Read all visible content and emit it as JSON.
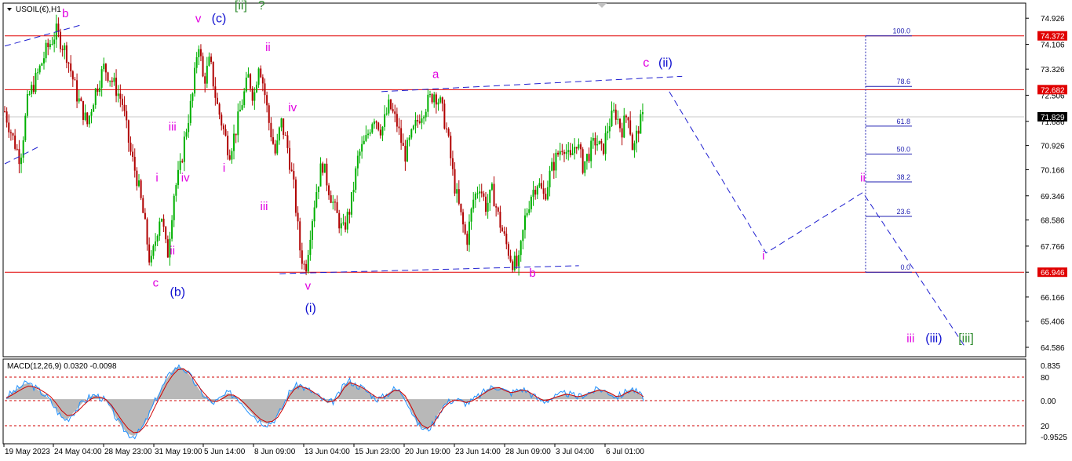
{
  "header": {
    "symbol_label": "USOIL(€),H1"
  },
  "chart_data": {
    "type": "candlestick",
    "price_axis": {
      "ticks": [
        "74.926",
        "74.106",
        "73.326",
        "72.506",
        "71.686",
        "70.926",
        "70.166",
        "69.346",
        "68.586",
        "67.766",
        "66.946",
        "66.166",
        "65.406",
        "64.586"
      ],
      "ylim": [
        64.34,
        75.35
      ]
    },
    "time_axis": {
      "ticks": [
        "19 May 2023",
        "24 May 04:00",
        "28 May 23:00",
        "31 May 19:00",
        "5 Jun 14:00",
        "8 Jun 09:00",
        "13 Jun 04:00",
        "15 Jun 23:00",
        "20 Jun 19:00",
        "23 Jun 14:00",
        "28 Jun 09:00",
        "3 Jul 04:00",
        "6 Jul 01:00"
      ]
    },
    "horizontal_levels": [
      {
        "price": 74.372,
        "label": "74.372",
        "color": "#e00000"
      },
      {
        "price": 72.682,
        "label": "72.682",
        "color": "#e00000"
      },
      {
        "price": 66.946,
        "label": "66.946",
        "color": "#e00000"
      }
    ],
    "current_price": {
      "price": 71.829,
      "label": "71.829"
    },
    "fibonacci": {
      "from": 66.946,
      "to": 74.372,
      "levels": [
        {
          "ratio": 1.0,
          "label": "100.0"
        },
        {
          "ratio": 0.786,
          "label": "78.6"
        },
        {
          "ratio": 0.618,
          "label": "61.8"
        },
        {
          "ratio": 0.5,
          "label": "50.0"
        },
        {
          "ratio": 0.382,
          "label": "38.2"
        },
        {
          "ratio": 0.236,
          "label": "23.6"
        },
        {
          "ratio": 0.0,
          "label": "0.0"
        }
      ]
    },
    "price_points": [
      {
        "t": 0,
        "p": 72.0
      },
      {
        "t": 6,
        "p": 71.2
      },
      {
        "t": 12,
        "p": 70.5
      },
      {
        "t": 18,
        "p": 72.4
      },
      {
        "t": 25,
        "p": 73.1
      },
      {
        "t": 32,
        "p": 73.9
      },
      {
        "t": 40,
        "p": 74.5
      },
      {
        "t": 48,
        "p": 73.8
      },
      {
        "t": 56,
        "p": 72.5
      },
      {
        "t": 64,
        "p": 71.6
      },
      {
        "t": 70,
        "p": 72.6
      },
      {
        "t": 77,
        "p": 73.4
      },
      {
        "t": 84,
        "p": 72.9
      },
      {
        "t": 91,
        "p": 72.3
      },
      {
        "t": 97,
        "p": 70.8
      },
      {
        "t": 103,
        "p": 69.8
      },
      {
        "t": 108,
        "p": 68.6
      },
      {
        "t": 113,
        "p": 67.1
      },
      {
        "t": 117,
        "p": 68.0
      },
      {
        "t": 121,
        "p": 68.9
      },
      {
        "t": 126,
        "p": 67.4
      },
      {
        "t": 131,
        "p": 69.4
      },
      {
        "t": 136,
        "p": 70.2
      },
      {
        "t": 140,
        "p": 71.3
      },
      {
        "t": 146,
        "p": 72.6
      },
      {
        "t": 150,
        "p": 74.3
      },
      {
        "t": 154,
        "p": 72.9
      },
      {
        "t": 159,
        "p": 73.6
      },
      {
        "t": 164,
        "p": 72.3
      },
      {
        "t": 169,
        "p": 71.5
      },
      {
        "t": 174,
        "p": 70.7
      },
      {
        "t": 179,
        "p": 71.4
      },
      {
        "t": 184,
        "p": 72.3
      },
      {
        "t": 189,
        "p": 73.1
      },
      {
        "t": 193,
        "p": 72.4
      },
      {
        "t": 197,
        "p": 73.6
      },
      {
        "t": 201,
        "p": 72.7
      },
      {
        "t": 205,
        "p": 71.6
      },
      {
        "t": 210,
        "p": 70.6
      },
      {
        "t": 214,
        "p": 71.7
      },
      {
        "t": 219,
        "p": 70.9
      },
      {
        "t": 224,
        "p": 69.6
      },
      {
        "t": 229,
        "p": 67.6
      },
      {
        "t": 233,
        "p": 67.0
      },
      {
        "t": 237,
        "p": 68.3
      },
      {
        "t": 241,
        "p": 69.4
      },
      {
        "t": 246,
        "p": 70.4
      },
      {
        "t": 251,
        "p": 69.6
      },
      {
        "t": 256,
        "p": 68.9
      },
      {
        "t": 262,
        "p": 68.2
      },
      {
        "t": 268,
        "p": 69.0
      },
      {
        "t": 274,
        "p": 70.6
      },
      {
        "t": 280,
        "p": 71.1
      },
      {
        "t": 286,
        "p": 71.9
      },
      {
        "t": 292,
        "p": 71.4
      },
      {
        "t": 298,
        "p": 72.2
      },
      {
        "t": 304,
        "p": 71.6
      },
      {
        "t": 310,
        "p": 70.6
      },
      {
        "t": 316,
        "p": 71.3
      },
      {
        "t": 322,
        "p": 71.9
      },
      {
        "t": 328,
        "p": 72.3
      },
      {
        "t": 333,
        "p": 72.6
      },
      {
        "t": 338,
        "p": 72.2
      },
      {
        "t": 343,
        "p": 71.3
      },
      {
        "t": 348,
        "p": 69.8
      },
      {
        "t": 353,
        "p": 68.8
      },
      {
        "t": 358,
        "p": 67.9
      },
      {
        "t": 363,
        "p": 69.2
      },
      {
        "t": 368,
        "p": 69.7
      },
      {
        "t": 373,
        "p": 69.0
      },
      {
        "t": 378,
        "p": 69.5
      },
      {
        "t": 383,
        "p": 68.6
      },
      {
        "t": 388,
        "p": 67.9
      },
      {
        "t": 393,
        "p": 67.3
      },
      {
        "t": 398,
        "p": 67.1
      },
      {
        "t": 403,
        "p": 68.6
      },
      {
        "t": 408,
        "p": 69.4
      },
      {
        "t": 413,
        "p": 69.8
      },
      {
        "t": 418,
        "p": 69.3
      },
      {
        "t": 423,
        "p": 70.1
      },
      {
        "t": 428,
        "p": 70.6
      },
      {
        "t": 433,
        "p": 71.0
      },
      {
        "t": 438,
        "p": 70.4
      },
      {
        "t": 443,
        "p": 71.1
      },
      {
        "t": 448,
        "p": 70.3
      },
      {
        "t": 453,
        "p": 70.7
      },
      {
        "t": 458,
        "p": 71.1
      },
      {
        "t": 463,
        "p": 70.7
      },
      {
        "t": 468,
        "p": 71.6
      },
      {
        "t": 473,
        "p": 72.0
      },
      {
        "t": 478,
        "p": 71.4
      },
      {
        "t": 483,
        "p": 72.0
      },
      {
        "t": 487,
        "p": 70.7
      },
      {
        "t": 491,
        "p": 71.5
      },
      {
        "t": 495,
        "p": 71.829
      }
    ],
    "wave_labels": [
      {
        "text": "b",
        "color": "#e000e0",
        "t": 47,
        "p": 74.95,
        "size": 15
      },
      {
        "text": "v",
        "color": "#e000e0",
        "t": 150,
        "p": 74.8,
        "size": 15
      },
      {
        "text": "(c)",
        "color": "#1010d0",
        "t": 166,
        "p": 74.8,
        "size": 16
      },
      {
        "text": "[ii]",
        "color": "#2e8b2e",
        "t": 183,
        "p": 75.2,
        "size": 16
      },
      {
        "text": "?",
        "color": "#2e8b2e",
        "t": 199,
        "p": 75.2,
        "size": 16
      },
      {
        "text": "ii",
        "color": "#e000e0",
        "t": 204,
        "p": 73.9,
        "size": 15
      },
      {
        "text": "iii",
        "color": "#e000e0",
        "t": 130,
        "p": 71.4,
        "size": 15
      },
      {
        "text": "iv",
        "color": "#e000e0",
        "t": 223,
        "p": 72.0,
        "size": 15
      },
      {
        "text": "iv",
        "color": "#e000e0",
        "t": 140,
        "p": 69.8,
        "size": 15
      },
      {
        "text": "i",
        "color": "#e000e0",
        "t": 118,
        "p": 69.8,
        "size": 15
      },
      {
        "text": "i",
        "color": "#e000e0",
        "t": 170,
        "p": 70.1,
        "size": 15
      },
      {
        "text": "iii",
        "color": "#e000e0",
        "t": 201,
        "p": 68.9,
        "size": 15
      },
      {
        "text": "ii",
        "color": "#e000e0",
        "t": 130,
        "p": 67.5,
        "size": 15
      },
      {
        "text": "c",
        "color": "#e000e0",
        "t": 117,
        "p": 66.5,
        "size": 15
      },
      {
        "text": "(b)",
        "color": "#1010d0",
        "t": 134,
        "p": 66.2,
        "size": 16
      },
      {
        "text": "v",
        "color": "#e000e0",
        "t": 235,
        "p": 66.4,
        "size": 15
      },
      {
        "text": "(i)",
        "color": "#1010d0",
        "t": 237,
        "p": 65.7,
        "size": 16
      },
      {
        "text": "a",
        "color": "#e000e0",
        "t": 334,
        "p": 73.05,
        "size": 15
      },
      {
        "text": "b",
        "color": "#e000e0",
        "t": 409,
        "p": 66.8,
        "size": 15
      },
      {
        "text": "c",
        "color": "#e000e0",
        "t": 497,
        "p": 73.4,
        "size": 16
      },
      {
        "text": "(ii)",
        "color": "#1010d0",
        "t": 512,
        "p": 73.4,
        "size": 16
      },
      {
        "text": "i",
        "color": "#e000e0",
        "t": 588,
        "p": 67.35,
        "size": 15
      },
      {
        "text": "ii",
        "color": "#e000e0",
        "t": 665,
        "p": 69.8,
        "size": 15
      },
      {
        "text": "iii",
        "color": "#e000e0",
        "t": 702,
        "p": 64.75,
        "size": 15
      },
      {
        "text": "(iii)",
        "color": "#1010d0",
        "t": 720,
        "p": 64.75,
        "size": 16
      },
      {
        "text": "[iii]",
        "color": "#2e8b2e",
        "t": 745,
        "p": 64.75,
        "size": 16
      }
    ],
    "trendlines": [
      {
        "from": {
          "t": 0,
          "p": 74.05
        },
        "to": {
          "t": 58,
          "p": 74.7
        }
      },
      {
        "from": {
          "t": 0,
          "p": 70.35
        },
        "to": {
          "t": 27,
          "p": 70.9
        }
      },
      {
        "from": {
          "t": 292,
          "p": 72.62
        },
        "to": {
          "t": 525,
          "p": 73.1
        }
      },
      {
        "from": {
          "t": 213,
          "p": 66.9
        },
        "to": {
          "t": 445,
          "p": 67.15
        }
      }
    ],
    "projection": [
      {
        "t": 515,
        "p": 72.62
      },
      {
        "t": 590,
        "p": 67.55
      },
      {
        "t": 665,
        "p": 69.45
      },
      {
        "t": 745,
        "p": 64.55
      }
    ],
    "macd": {
      "label": "MACD(12,26,9) 0.0320 -0.0098",
      "axis_ticks": [
        "0.835",
        "80",
        "0.00",
        "20",
        "-0.9525"
      ],
      "ylim": [
        -1.05,
        0.94
      ],
      "levels": [
        80,
        50,
        20
      ],
      "histogram": [
        0.05,
        0.15,
        0.25,
        0.35,
        0.4,
        0.3,
        0.2,
        0.1,
        -0.05,
        -0.25,
        -0.45,
        -0.5,
        -0.35,
        -0.2,
        -0.05,
        0.05,
        0.1,
        0.05,
        -0.05,
        -0.25,
        -0.5,
        -0.7,
        -0.85,
        -0.9,
        -0.8,
        -0.6,
        -0.3,
        0.0,
        0.25,
        0.5,
        0.7,
        0.8,
        0.75,
        0.6,
        0.4,
        0.2,
        0.05,
        -0.1,
        -0.05,
        0.05,
        0.15,
        0.1,
        0.0,
        -0.15,
        -0.3,
        -0.45,
        -0.55,
        -0.6,
        -0.55,
        -0.4,
        -0.15,
        0.15,
        0.3,
        0.35,
        0.25,
        0.2,
        0.1,
        0.0,
        -0.1,
        -0.05,
        0.1,
        0.35,
        0.45,
        0.35,
        0.3,
        0.2,
        0.1,
        0.0,
        0.05,
        0.15,
        0.25,
        0.2,
        0.05,
        -0.25,
        -0.55,
        -0.7,
        -0.75,
        -0.6,
        -0.35,
        -0.15,
        -0.05,
        0.0,
        -0.05,
        -0.1,
        -0.05,
        0.05,
        0.15,
        0.25,
        0.3,
        0.3,
        0.2,
        0.15,
        0.2,
        0.25,
        0.2,
        0.1,
        0.0,
        -0.05,
        0.0,
        0.05,
        0.1,
        0.15,
        0.1,
        0.05,
        0.1,
        0.15,
        0.2,
        0.25,
        0.2,
        0.15,
        0.05,
        0.1,
        0.2,
        0.25,
        0.15,
        0.03
      ],
      "signal": [
        0.03,
        0.1,
        0.18,
        0.26,
        0.32,
        0.3,
        0.24,
        0.16,
        0.06,
        -0.1,
        -0.28,
        -0.4,
        -0.38,
        -0.28,
        -0.14,
        -0.02,
        0.05,
        0.05,
        -0.01,
        -0.15,
        -0.35,
        -0.55,
        -0.72,
        -0.82,
        -0.8,
        -0.66,
        -0.42,
        -0.14,
        0.12,
        0.38,
        0.58,
        0.72,
        0.74,
        0.64,
        0.46,
        0.26,
        0.1,
        -0.04,
        -0.06,
        0.01,
        0.1,
        0.1,
        0.02,
        -0.1,
        -0.24,
        -0.38,
        -0.5,
        -0.56,
        -0.54,
        -0.44,
        -0.22,
        0.06,
        0.24,
        0.32,
        0.27,
        0.21,
        0.12,
        0.02,
        -0.07,
        -0.05,
        0.06,
        0.28,
        0.4,
        0.36,
        0.3,
        0.22,
        0.12,
        0.03,
        0.04,
        0.12,
        0.21,
        0.2,
        0.08,
        -0.16,
        -0.44,
        -0.63,
        -0.71,
        -0.62,
        -0.4,
        -0.2,
        -0.08,
        -0.02,
        -0.04,
        -0.08,
        -0.05,
        0.03,
        0.12,
        0.21,
        0.27,
        0.28,
        0.21,
        0.16,
        0.18,
        0.22,
        0.2,
        0.12,
        0.03,
        -0.03,
        -0.01,
        0.04,
        0.08,
        0.12,
        0.1,
        0.06,
        0.08,
        0.13,
        0.18,
        0.22,
        0.2,
        0.15,
        0.07,
        0.08,
        0.16,
        0.21,
        0.16,
        0.06
      ]
    }
  }
}
